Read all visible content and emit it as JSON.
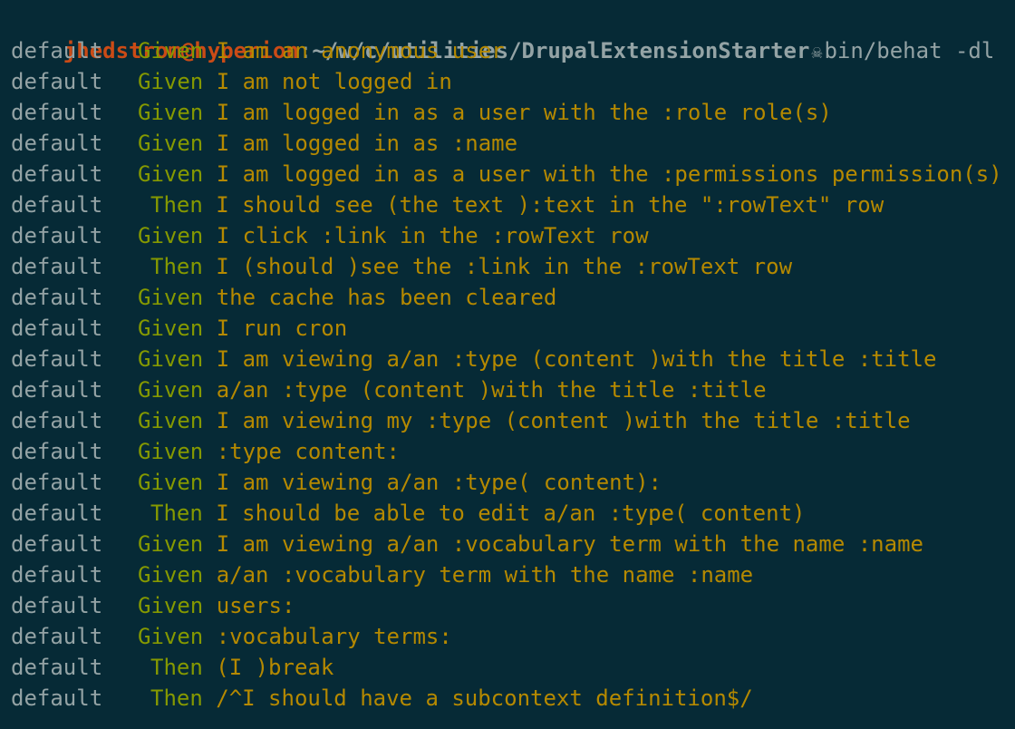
{
  "prompt": {
    "user_host": "jhedstrom@hyperion",
    "separator": ":",
    "path": "~/w/c/utilities/DrupalExtensionStarter",
    "icon": "skull-icon",
    "command": "bin/behat -dl"
  },
  "colors": {
    "background": "#062a36",
    "context": "#94a3a5",
    "keyword": "#859900",
    "step_text": "#b58900",
    "prompt_user": "#cb4b16"
  },
  "lines": [
    {
      "context": "default",
      "keyword": "Given",
      "text": "I am an anonymous user"
    },
    {
      "context": "default",
      "keyword": "Given",
      "text": "I am not logged in"
    },
    {
      "context": "default",
      "keyword": "Given",
      "text": "I am logged in as a user with the :role role(s)"
    },
    {
      "context": "default",
      "keyword": "Given",
      "text": "I am logged in as :name"
    },
    {
      "context": "default",
      "keyword": "Given",
      "text": "I am logged in as a user with the :permissions permission(s)"
    },
    {
      "context": "default",
      "keyword": "Then",
      "text": "I should see (the text ):text in the \":rowText\" row"
    },
    {
      "context": "default",
      "keyword": "Given",
      "text": "I click :link in the :rowText row"
    },
    {
      "context": "default",
      "keyword": "Then",
      "text": "I (should )see the :link in the :rowText row"
    },
    {
      "context": "default",
      "keyword": "Given",
      "text": "the cache has been cleared"
    },
    {
      "context": "default",
      "keyword": "Given",
      "text": "I run cron"
    },
    {
      "context": "default",
      "keyword": "Given",
      "text": "I am viewing a/an :type (content )with the title :title"
    },
    {
      "context": "default",
      "keyword": "Given",
      "text": "a/an :type (content )with the title :title"
    },
    {
      "context": "default",
      "keyword": "Given",
      "text": "I am viewing my :type (content )with the title :title"
    },
    {
      "context": "default",
      "keyword": "Given",
      "text": ":type content:"
    },
    {
      "context": "default",
      "keyword": "Given",
      "text": "I am viewing a/an :type( content):"
    },
    {
      "context": "default",
      "keyword": "Then",
      "text": "I should be able to edit a/an :type( content)"
    },
    {
      "context": "default",
      "keyword": "Given",
      "text": "I am viewing a/an :vocabulary term with the name :name"
    },
    {
      "context": "default",
      "keyword": "Given",
      "text": "a/an :vocabulary term with the name :name"
    },
    {
      "context": "default",
      "keyword": "Given",
      "text": "users:"
    },
    {
      "context": "default",
      "keyword": "Given",
      "text": ":vocabulary terms:"
    },
    {
      "context": "default",
      "keyword": "Then",
      "text": "(I )break"
    },
    {
      "context": "default",
      "keyword": "Then",
      "text": "/^I should have a subcontext definition$/"
    }
  ]
}
